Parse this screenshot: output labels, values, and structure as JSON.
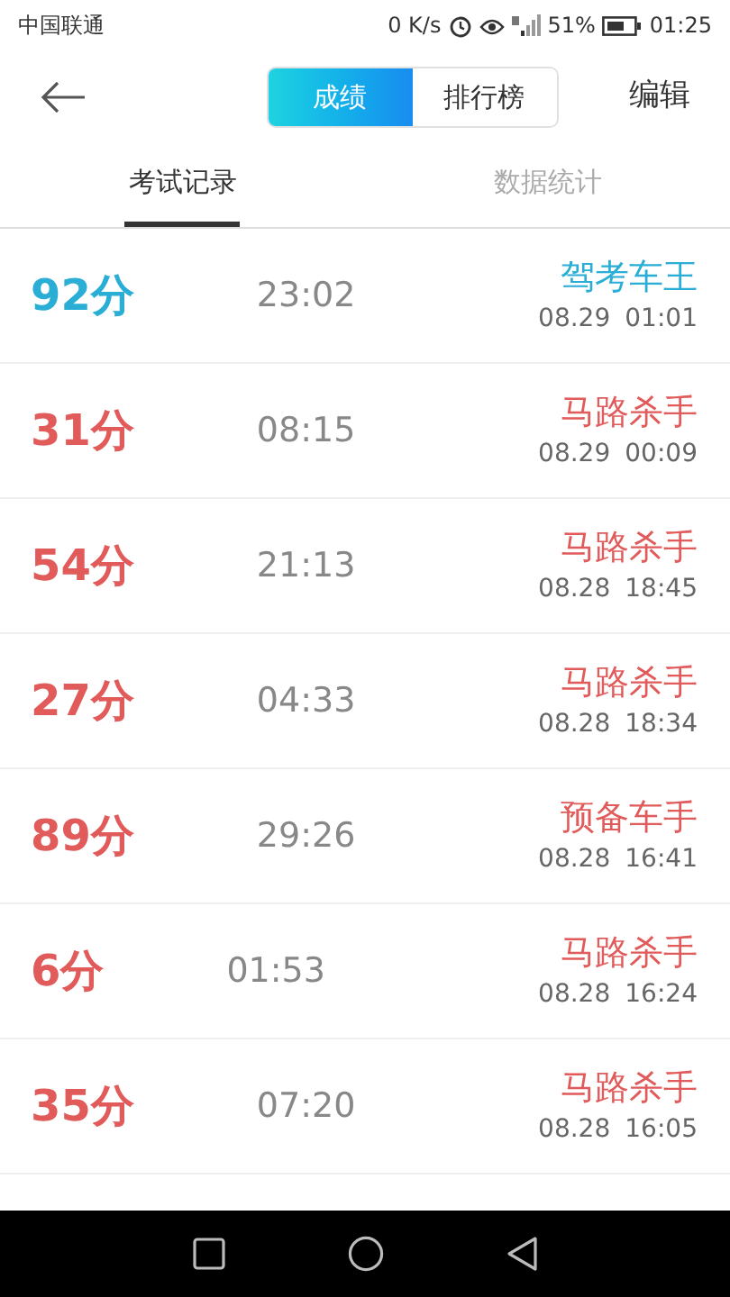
{
  "status_bar": {
    "carrier": "中国联通",
    "speed": "0 K/s",
    "battery": "51%",
    "time": "01:25"
  },
  "header": {
    "segments": [
      {
        "label": "成绩",
        "selected": true
      },
      {
        "label": "排行榜",
        "selected": false
      }
    ],
    "action": "编辑"
  },
  "tabs": [
    {
      "label": "考试记录",
      "selected": true
    },
    {
      "label": "数据统计",
      "selected": false
    }
  ],
  "records": [
    {
      "score": "92分",
      "duration": "23:02",
      "title": "驾考车王",
      "date": "08.29",
      "time": "01:01",
      "color": "#2aaed6"
    },
    {
      "score": "31分",
      "duration": "08:15",
      "title": "马路杀手",
      "date": "08.29",
      "time": "00:09",
      "color": "#e25b5b"
    },
    {
      "score": "54分",
      "duration": "21:13",
      "title": "马路杀手",
      "date": "08.28",
      "time": "18:45",
      "color": "#e25b5b"
    },
    {
      "score": "27分",
      "duration": "04:33",
      "title": "马路杀手",
      "date": "08.28",
      "time": "18:34",
      "color": "#e25b5b"
    },
    {
      "score": "89分",
      "duration": "29:26",
      "title": "预备车手",
      "date": "08.28",
      "time": "16:41",
      "color": "#e25b5b"
    },
    {
      "score": "6分",
      "duration": "01:53",
      "title": "马路杀手",
      "date": "08.28",
      "time": "16:24",
      "color": "#e25b5b"
    },
    {
      "score": "35分",
      "duration": "07:20",
      "title": "马路杀手",
      "date": "08.28",
      "time": "16:05",
      "color": "#e25b5b"
    }
  ]
}
